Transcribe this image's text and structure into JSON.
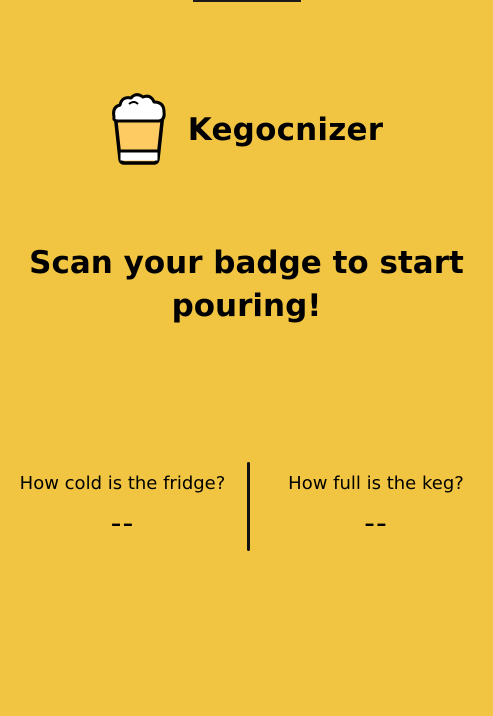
{
  "app": {
    "name": "Kegocnizer",
    "logo_icon": "beer-glass-icon"
  },
  "prompt": "Scan your badge to start pouring!",
  "stats": {
    "fridge": {
      "label": "How cold is the fridge?",
      "value": "--"
    },
    "keg": {
      "label": "How full is the keg?",
      "value": "--"
    }
  },
  "colors": {
    "background": "#F1C542",
    "beer": "#FECB62",
    "foam": "#FFFFFF",
    "text": "#000000"
  }
}
